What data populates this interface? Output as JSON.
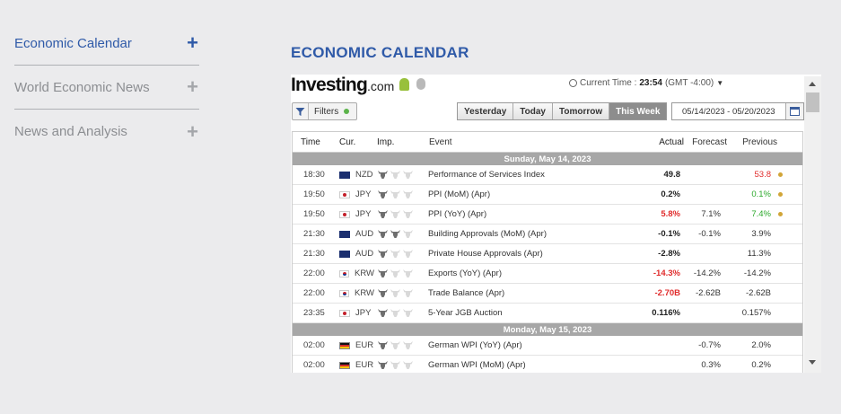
{
  "sidebar": {
    "items": [
      {
        "label": "Economic Calendar",
        "active": true
      },
      {
        "label": "World Economic News",
        "active": false
      },
      {
        "label": "News and Analysis",
        "active": false
      }
    ],
    "expand_glyph": "+"
  },
  "page_heading": "ECONOMIC CALENDAR",
  "widget": {
    "logo_main": "Investing",
    "logo_suffix": ".com",
    "current_time_label": "Current Time :",
    "current_time_value": "23:54",
    "timezone": "(GMT -4:00)",
    "filters_label": "Filters",
    "tabs": [
      "Yesterday",
      "Today",
      "Tomorrow",
      "This Week"
    ],
    "active_tab": "This Week",
    "date_range": "05/14/2023 - 05/20/2023",
    "columns": [
      "Time",
      "Cur.",
      "Imp.",
      "Event",
      "Actual",
      "Forecast",
      "Previous"
    ],
    "days": [
      {
        "label": "Sunday, May 14, 2023",
        "rows": [
          {
            "time": "18:30",
            "cur": "NZD",
            "flag": "nzd",
            "imp": 1,
            "event": "Performance of Services Index",
            "actual": "49.8",
            "actual_color": "",
            "forecast": "",
            "previous": "53.8",
            "previous_color": "red",
            "revised": true
          },
          {
            "time": "19:50",
            "cur": "JPY",
            "flag": "jpy",
            "imp": 1,
            "event": "PPI (MoM) (Apr)",
            "actual": "0.2%",
            "actual_color": "",
            "forecast": "",
            "previous": "0.1%",
            "previous_color": "green",
            "revised": true
          },
          {
            "time": "19:50",
            "cur": "JPY",
            "flag": "jpy",
            "imp": 1,
            "event": "PPI (YoY) (Apr)",
            "actual": "5.8%",
            "actual_color": "red",
            "forecast": "7.1%",
            "previous": "7.4%",
            "previous_color": "green",
            "revised": true
          },
          {
            "time": "21:30",
            "cur": "AUD",
            "flag": "aud",
            "imp": 2,
            "event": "Building Approvals (MoM) (Apr)",
            "actual": "-0.1%",
            "actual_color": "",
            "forecast": "-0.1%",
            "previous": "3.9%",
            "previous_color": "",
            "revised": false
          },
          {
            "time": "21:30",
            "cur": "AUD",
            "flag": "aud",
            "imp": 1,
            "event": "Private House Approvals (Apr)",
            "actual": "-2.8%",
            "actual_color": "",
            "forecast": "",
            "previous": "11.3%",
            "previous_color": "",
            "revised": false
          },
          {
            "time": "22:00",
            "cur": "KRW",
            "flag": "krw",
            "imp": 1,
            "event": "Exports (YoY) (Apr)",
            "actual": "-14.3%",
            "actual_color": "red",
            "forecast": "-14.2%",
            "previous": "-14.2%",
            "previous_color": "",
            "revised": false
          },
          {
            "time": "22:00",
            "cur": "KRW",
            "flag": "krw",
            "imp": 1,
            "event": "Trade Balance (Apr)",
            "actual": "-2.70B",
            "actual_color": "red",
            "forecast": "-2.62B",
            "previous": "-2.62B",
            "previous_color": "",
            "revised": false
          },
          {
            "time": "23:35",
            "cur": "JPY",
            "flag": "jpy",
            "imp": 1,
            "event": "5-Year JGB Auction",
            "actual": "0.116%",
            "actual_color": "",
            "forecast": "",
            "previous": "0.157%",
            "previous_color": "",
            "revised": false
          }
        ]
      },
      {
        "label": "Monday, May 15, 2023",
        "rows": [
          {
            "time": "02:00",
            "cur": "EUR",
            "flag": "eur",
            "imp": 1,
            "event": "German WPI (YoY) (Apr)",
            "actual": "",
            "actual_color": "",
            "forecast": "-0.7%",
            "previous": "2.0%",
            "previous_color": "",
            "revised": false
          },
          {
            "time": "02:00",
            "cur": "EUR",
            "flag": "eur",
            "imp": 1,
            "event": "German WPI (MoM) (Apr)",
            "actual": "",
            "actual_color": "",
            "forecast": "0.3%",
            "previous": "0.2%",
            "previous_color": "",
            "revised": false
          }
        ]
      }
    ]
  },
  "colors": {
    "accent": "#2f5aa8",
    "negative": "#e02b2b",
    "positive": "#2aa82a",
    "day_bar": "#a7a7a7",
    "active_tab": "#8d8d8d"
  }
}
